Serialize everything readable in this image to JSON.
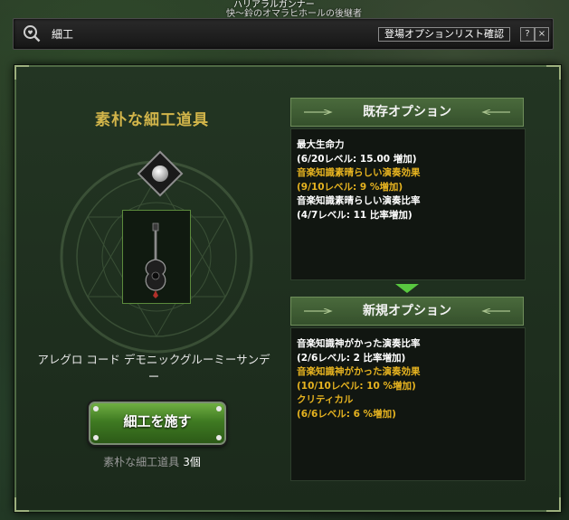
{
  "world": {
    "name_top": "ハリアラルガンナー",
    "name_sub": "快～鈴のオマラヒホールの後継者"
  },
  "search": {
    "value": "細工",
    "option_list_button": "登場オプションリスト確認",
    "help_button": "?",
    "close_button": "×"
  },
  "tool": {
    "title": "素朴な細工道具",
    "item_name": "アレグロ コード デモニックグルーミーサンデー",
    "craft_button": "細工を施す",
    "material_label": "素朴な細工道具",
    "material_count": "3個"
  },
  "existing_options": {
    "header": "既存オプション",
    "lines": [
      {
        "text": "最大生命力",
        "color": "#ffffff"
      },
      {
        "text": "(6/20レベル: 15.00 増加)",
        "color": "#ffffff"
      },
      {
        "text": "音楽知識素晴らしい演奏効果",
        "color": "#e6b320"
      },
      {
        "text": "(9/10レベル: 9 %増加)",
        "color": "#e6b320"
      },
      {
        "text": "音楽知識素晴らしい演奏比率",
        "color": "#ffffff"
      },
      {
        "text": "(4/7レベル: 11 比率増加)",
        "color": "#ffffff"
      }
    ]
  },
  "new_options": {
    "header": "新規オプション",
    "lines": [
      {
        "text": "音楽知識神がかった演奏比率",
        "color": "#ffffff"
      },
      {
        "text": "(2/6レベル: 2 比率増加)",
        "color": "#ffffff"
      },
      {
        "text": "音楽知識神がかった演奏効果",
        "color": "#e6b320"
      },
      {
        "text": "(10/10レベル: 10 %増加)",
        "color": "#e6b320"
      },
      {
        "text": "クリティカル",
        "color": "#e6b320"
      },
      {
        "text": "(6/6レベル: 6 %増加)",
        "color": "#e6b320"
      }
    ]
  },
  "colors": {
    "accent_gold": "#d2b54a",
    "option_orange": "#e6b320",
    "arrow_green": "#59c940"
  }
}
